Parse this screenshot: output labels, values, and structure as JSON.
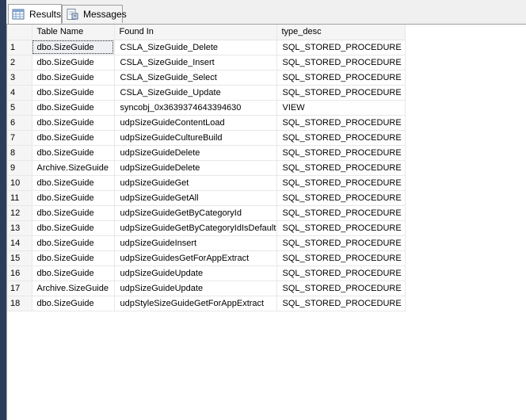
{
  "tabs": [
    {
      "label": "Results",
      "icon": "grid-icon",
      "active": true
    },
    {
      "label": "Messages",
      "icon": "messages-icon",
      "active": false
    }
  ],
  "table": {
    "columns": [
      "",
      "Table Name",
      "Found In",
      "type_desc"
    ],
    "rows": [
      [
        "1",
        "dbo.SizeGuide",
        "CSLA_SizeGuide_Delete",
        "SQL_STORED_PROCEDURE"
      ],
      [
        "2",
        "dbo.SizeGuide",
        "CSLA_SizeGuide_Insert",
        "SQL_STORED_PROCEDURE"
      ],
      [
        "3",
        "dbo.SizeGuide",
        "CSLA_SizeGuide_Select",
        "SQL_STORED_PROCEDURE"
      ],
      [
        "4",
        "dbo.SizeGuide",
        "CSLA_SizeGuide_Update",
        "SQL_STORED_PROCEDURE"
      ],
      [
        "5",
        "dbo.SizeGuide",
        "syncobj_0x3639374643394630",
        "VIEW"
      ],
      [
        "6",
        "dbo.SizeGuide",
        "udpSizeGuideContentLoad",
        "SQL_STORED_PROCEDURE"
      ],
      [
        "7",
        "dbo.SizeGuide",
        "udpSizeGuideCultureBuild",
        "SQL_STORED_PROCEDURE"
      ],
      [
        "8",
        "dbo.SizeGuide",
        "udpSizeGuideDelete",
        "SQL_STORED_PROCEDURE"
      ],
      [
        "9",
        "Archive.SizeGuide",
        "udpSizeGuideDelete",
        "SQL_STORED_PROCEDURE"
      ],
      [
        "10",
        "dbo.SizeGuide",
        "udpSizeGuideGet",
        "SQL_STORED_PROCEDURE"
      ],
      [
        "11",
        "dbo.SizeGuide",
        "udpSizeGuideGetAll",
        "SQL_STORED_PROCEDURE"
      ],
      [
        "12",
        "dbo.SizeGuide",
        "udpSizeGuideGetByCategoryId",
        "SQL_STORED_PROCEDURE"
      ],
      [
        "13",
        "dbo.SizeGuide",
        "udpSizeGuideGetByCategoryIdIsDefault",
        "SQL_STORED_PROCEDURE"
      ],
      [
        "14",
        "dbo.SizeGuide",
        "udpSizeGuideInsert",
        "SQL_STORED_PROCEDURE"
      ],
      [
        "15",
        "dbo.SizeGuide",
        "udpSizeGuidesGetForAppExtract",
        "SQL_STORED_PROCEDURE"
      ],
      [
        "16",
        "dbo.SizeGuide",
        "udpSizeGuideUpdate",
        "SQL_STORED_PROCEDURE"
      ],
      [
        "17",
        "Archive.SizeGuide",
        "udpSizeGuideUpdate",
        "SQL_STORED_PROCEDURE"
      ],
      [
        "18",
        "dbo.SizeGuide",
        "udpStyleSizeGuideGetForAppExtract",
        "SQL_STORED_PROCEDURE"
      ]
    ],
    "selected_cell": {
      "row": 0,
      "col": 1
    }
  }
}
